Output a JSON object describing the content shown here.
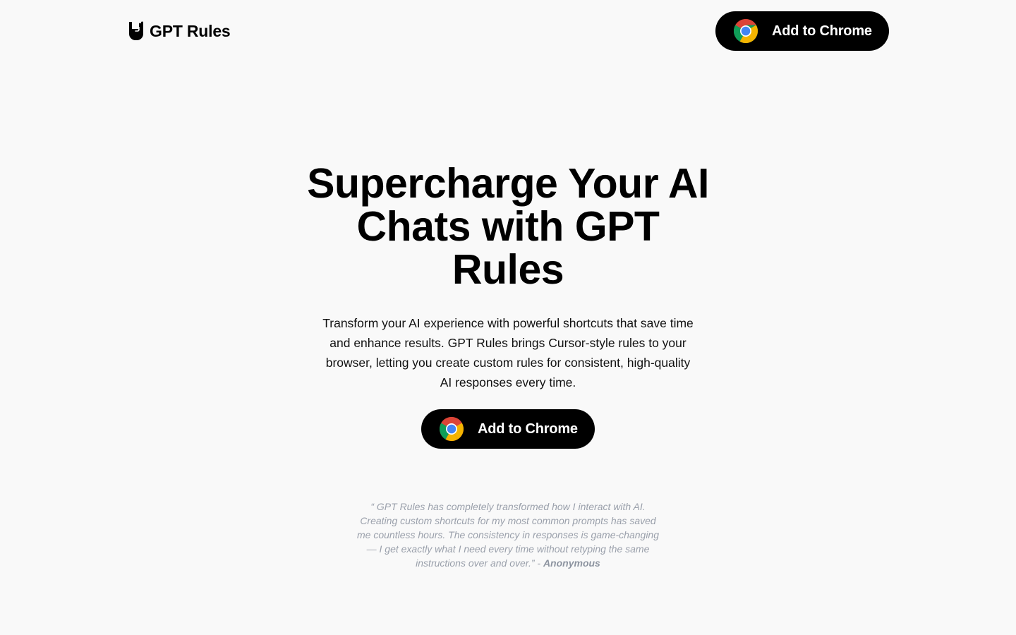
{
  "header": {
    "brand_name": "GPT Rules",
    "brand_icon": "rock-hand-icon",
    "cta_label": "Add to Chrome",
    "cta_icon": "chrome-icon"
  },
  "hero": {
    "title": "Supercharge Your AI Chats with GPT Rules",
    "subtitle": "Transform your AI experience with powerful shortcuts that save time and enhance results. GPT Rules brings Cursor-style rules to your browser, letting you create custom rules for consistent, high-quality AI responses every time.",
    "cta_label": "Add to Chrome",
    "cta_icon": "chrome-icon"
  },
  "testimonial": {
    "quote": "“ GPT Rules has completely transformed how I interact with AI. Creating custom shortcuts for my most common prompts has saved me countless hours. The consistency in responses is game-changing — I get exactly what I need every time without retyping the same instructions over and over.” - ",
    "author": "Anonymous"
  },
  "colors": {
    "background": "#f9f9f9",
    "button_bg": "#000000",
    "button_text": "#ffffff",
    "testimonial_text": "#9aa0ab"
  }
}
